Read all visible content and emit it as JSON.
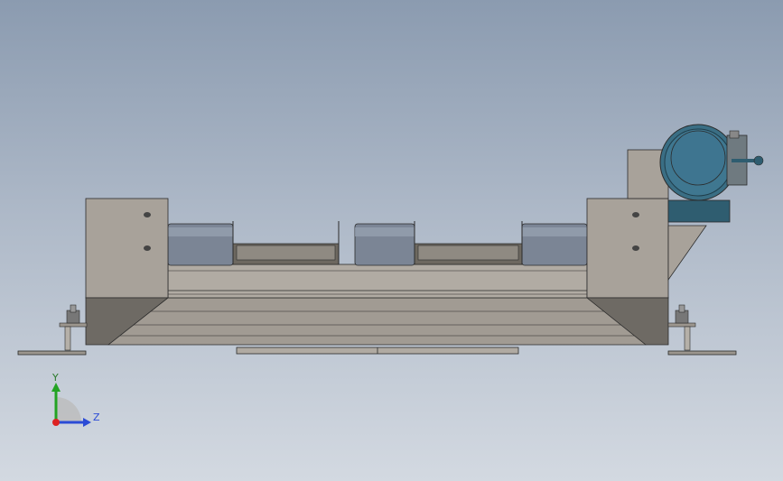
{
  "viewport": {
    "background_top": "#8b9bb0",
    "background_bottom": "#d3d9e1"
  },
  "model": {
    "description_icons": [
      "conveyor-frame",
      "motor-icon",
      "roller-icon",
      "anchor-bolt-icon"
    ],
    "colors": {
      "frame": "#a8a29a",
      "frame_shadow": "#8a847c",
      "roller": "#7b8595",
      "motor": "#2f5d70",
      "outline": "#2b2b2b"
    }
  },
  "triad": {
    "y_label": "Y",
    "z_label": "Z",
    "y_color": "#23a323",
    "z_color": "#2b4bd6",
    "origin_color": "#d22"
  }
}
